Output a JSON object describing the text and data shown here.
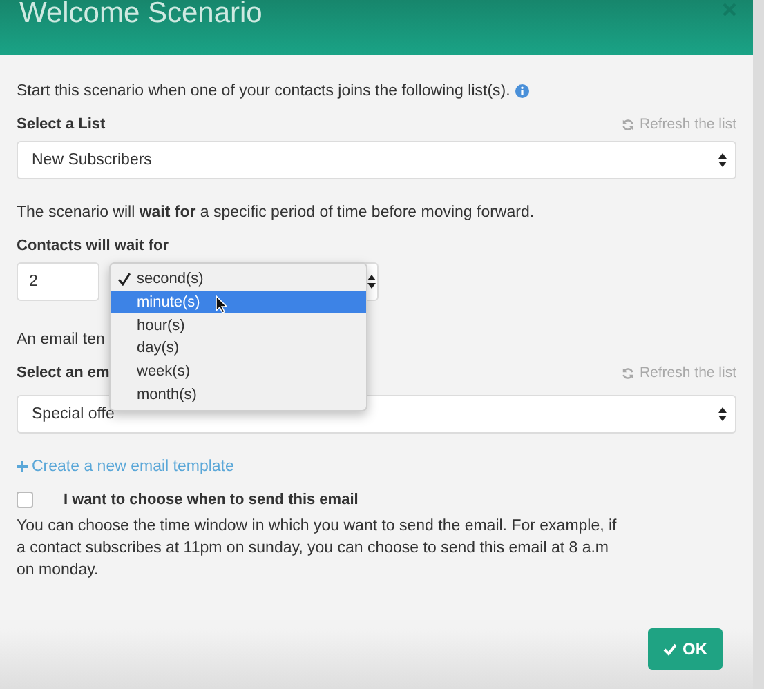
{
  "dialog": {
    "title": "Welcome Scenario"
  },
  "intro": "Start this scenario when one of your contacts joins the following list(s).",
  "list_field": {
    "label": "Select a List",
    "refresh": "Refresh the list",
    "value": "New Subscribers"
  },
  "wait_text": "The scenario will **wait for** a specific period of time before moving forward.",
  "wait_field": {
    "label": "Contacts will wait for",
    "amount": "2"
  },
  "unit_menu": [
    {
      "label": "second(s)",
      "selected": true,
      "highlighted": false
    },
    {
      "label": "minute(s)",
      "selected": false,
      "highlighted": true
    },
    {
      "label": "hour(s)",
      "selected": false,
      "highlighted": false
    },
    {
      "label": "day(s)",
      "selected": false,
      "highlighted": false
    },
    {
      "label": "week(s)",
      "selected": false,
      "highlighted": false
    },
    {
      "label": "month(s)",
      "selected": false,
      "highlighted": false
    }
  ],
  "template_text": "An email ten",
  "template_field": {
    "label": "Select an em",
    "refresh": "Refresh the list",
    "value": "Special offe"
  },
  "create_link": "Create a new email template",
  "send_option": {
    "label": "I want to choose when to send this email",
    "checked": false
  },
  "help": "You can choose the time window in which you want to send the email. For example, if a contact subscribes at 11pm on sunday, you can choose to send this email at 8 a.m on monday.",
  "ok_button": "OK"
}
